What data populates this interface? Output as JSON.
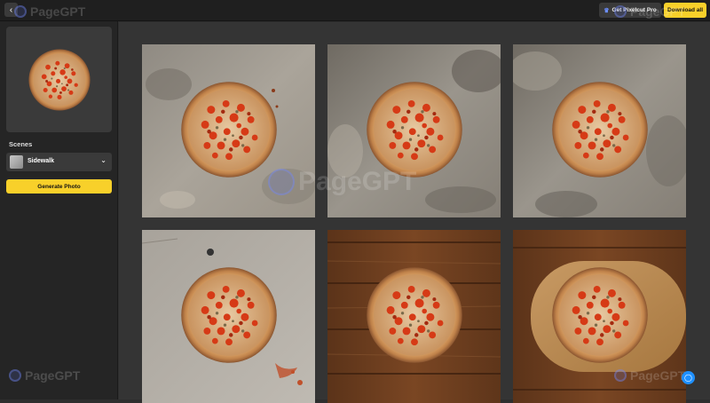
{
  "topbar": {
    "back_icon": "chevron-left-icon",
    "pro_label": "Get Pixelcut Pro",
    "pro_icon": "crown-icon",
    "download_label": "Download all"
  },
  "sidebar": {
    "scenes_label": "Scenes",
    "scene_selected": "Sidewalk",
    "generate_label": "Generate Photo"
  },
  "watermark": {
    "text": "PageGPT"
  },
  "grid": {
    "tiles": [
      {
        "background": "concrete"
      },
      {
        "background": "concrete"
      },
      {
        "background": "concrete"
      },
      {
        "background": "concrete"
      },
      {
        "background": "wood"
      },
      {
        "background": "wood-board"
      }
    ]
  },
  "colors": {
    "accent_yellow": "#f8d02a",
    "help_blue": "#1e90ff",
    "sidebar_bg": "#252525",
    "main_bg": "#343434"
  }
}
